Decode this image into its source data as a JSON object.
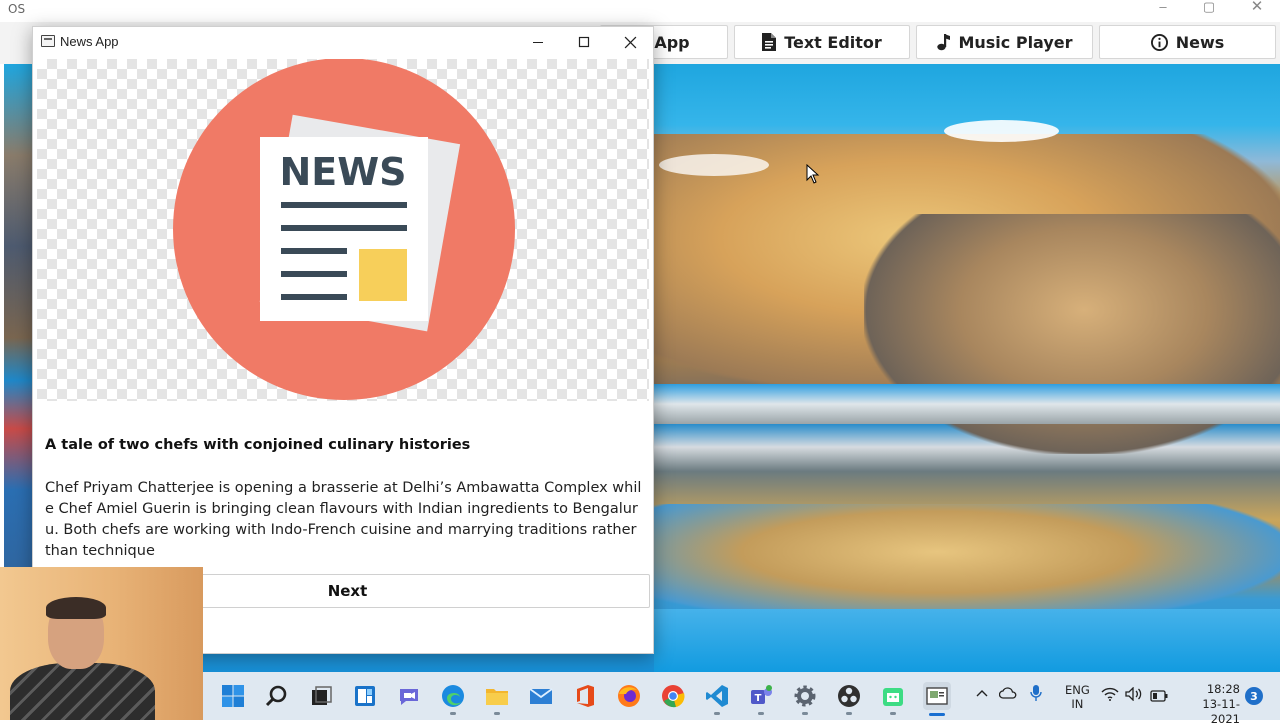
{
  "os_window": {
    "title": "OS"
  },
  "nav": {
    "items": [
      {
        "label": "y App",
        "icon": "app-icon"
      },
      {
        "label": "Text Editor",
        "icon": "file-text-icon"
      },
      {
        "label": "Music Player",
        "icon": "music-note-icon"
      },
      {
        "label": "News",
        "icon": "info-circle-icon"
      }
    ]
  },
  "news_app": {
    "title": "News App",
    "logo_text": "NEWS",
    "headline": "A tale of two chefs with conjoined culinary histories",
    "body": "Chef Priyam Chatterjee is opening a brasserie at Delhi’s Ambawatta Complex while Chef Amiel Guerin is bringing clean flavours with Indian ingredients to Bengaluru. Both chefs are working with Indo-French cuisine and marrying traditions rather than technique",
    "next_label": "Next",
    "colors": {
      "logo_circle": "#f07a66",
      "logo_lines": "#3a4a57",
      "logo_box": "#f7cf5a"
    }
  },
  "taskbar": {
    "apps": [
      "start-icon",
      "search-icon",
      "task-view-icon",
      "widgets-icon",
      "chat-icon",
      "edge-icon",
      "file-explorer-icon",
      "mail-icon",
      "office-icon",
      "firefox-icon",
      "chrome-icon",
      "vscode-icon",
      "teams-icon",
      "settings-icon",
      "obs-icon",
      "android-studio-icon",
      "news-app-taskbar-icon"
    ],
    "lang_top": "ENG",
    "lang_bottom": "IN",
    "time": "18:28",
    "date": "13-11-2021",
    "notifications": "3"
  }
}
